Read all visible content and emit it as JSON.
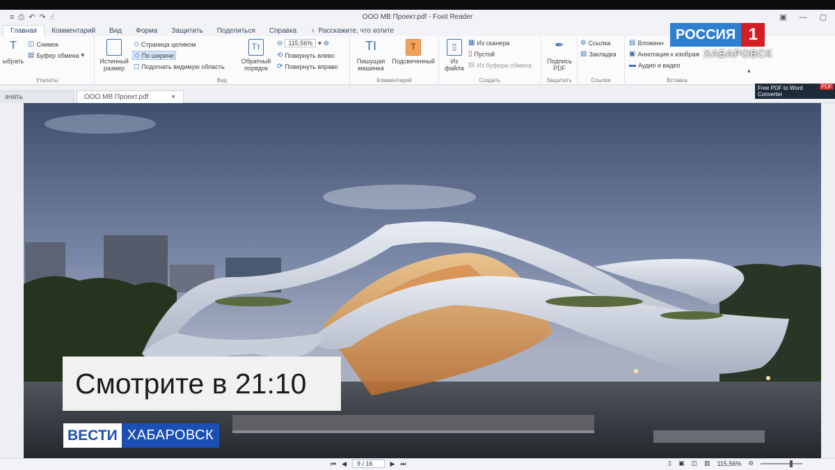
{
  "window": {
    "title": "ООО МВ Проект.pdf - Foxit Reader",
    "quick_access": [
      "≡",
      "⎙",
      "↶",
      "↷",
      "☝"
    ],
    "controls": [
      "▣",
      "—",
      "▢"
    ]
  },
  "menu": {
    "tabs": [
      "Главная",
      "Комментарий",
      "Вид",
      "Форма",
      "Защитить",
      "Поделиться",
      "Справка"
    ],
    "active_tab": "Главная",
    "tell_me": "Расскажите, что хотите"
  },
  "ribbon": {
    "tools": {
      "select_label": "ыбрать",
      "snapshot": "Снимок",
      "clipboard": "Буфер обмена",
      "group_label": "Утилиты"
    },
    "view": {
      "actual_size": "Истинный размер",
      "fit_page": "Страница целиком",
      "fit_width": "По ширине",
      "fit_visible": "Подогнать видимую область",
      "zoom_value": "115,56%",
      "rotate_left": "Повернуть влево",
      "rotate_right": "Повернуть вправо",
      "reverse_order": "Обратный порядок",
      "group_label": "Вид"
    },
    "comment": {
      "typewriter": "Пишущая машинка",
      "highlight": "Подсвеченный",
      "group_label": "Комментарий"
    },
    "create": {
      "from_file": "Из файла",
      "from_scanner": "Из сканера",
      "blank": "Пустой",
      "from_clipboard": "Из буфера обмена",
      "group_label": "Создать"
    },
    "protect": {
      "sign_pdf": "Подпись PDF",
      "group_label": "Защитить"
    },
    "links": {
      "link": "Ссылка",
      "bookmark": "Закладка",
      "group_label": "Ссылки"
    },
    "insert": {
      "attachment": "Вложенн",
      "annotation": "Аннотация к изображ",
      "audio_video": "Аудио и видео",
      "group_label": "Вставка"
    }
  },
  "doc_tabs": {
    "start": "ачать",
    "file": "ООО МВ Проект.pdf",
    "close": "×"
  },
  "ad": {
    "line1": "Free PDF to Word",
    "line2": "Converter",
    "badge": "PDF"
  },
  "statusbar": {
    "page": "9 / 16",
    "zoom": "115,56%",
    "nav_first": "⏮",
    "nav_prev": "◀",
    "nav_next": "▶",
    "nav_last": "⏭"
  },
  "broadcast": {
    "channel": "РОССИЯ",
    "channel_num": "1",
    "city": "ХАБАРОВСК",
    "promo": "Смотрите в 21:10",
    "program": "ВЕСТИ",
    "program_city": "ХАБАРОВСК"
  },
  "colors": {
    "rossiya_blue": "#2f7fd0",
    "rossiya_red": "#d41d25",
    "vesti_blue": "#1c4fb3",
    "ribbon_icon": "#3b6fa8"
  }
}
